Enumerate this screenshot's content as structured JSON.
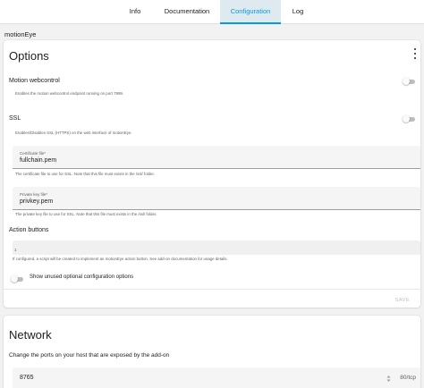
{
  "tabs": [
    {
      "label": "Info",
      "active": false
    },
    {
      "label": "Documentation",
      "active": false
    },
    {
      "label": "Configuration",
      "active": true
    },
    {
      "label": "Log",
      "active": false
    }
  ],
  "addon_name": "motionEye",
  "options": {
    "title": "Options",
    "motion_webcontrol": {
      "label": "Motion webcontrol",
      "description": "Enables the motion webcontrol endpoint running on port 7999.",
      "enabled": false
    },
    "ssl": {
      "label": "SSL",
      "description": "Enables/Disables SSL (HTTPS) on the web interface of motionEye.",
      "enabled": false
    },
    "certfile": {
      "label": "Certificate file*",
      "value": "fullchain.pem",
      "description": "The certificate file to use for SSL. Note that this file must exists in the /ssl/ folder."
    },
    "keyfile": {
      "label": "Private key file*",
      "value": "privkey.pem",
      "description": "The private key file to use for SSL. Note that this file must exists in the /ssl/ folder."
    },
    "action_buttons": {
      "label": "Action buttons",
      "line_number": "1",
      "description": "If configured, a script will be created to implement an motionEye action button. See add-on documentation for usage details."
    },
    "show_unused": {
      "label": "Show unused optional configuration options",
      "enabled": false
    },
    "save_label": "SAVE"
  },
  "network": {
    "title": "Network",
    "description": "Change the ports on your host that are exposed by the add-on",
    "port_value": "8765",
    "port_unit": "80/tcp"
  },
  "colors": {
    "accent": "#039be5",
    "active_tab_bg": "#dfeaf0",
    "switch_off_track": "#bdbdbd"
  }
}
